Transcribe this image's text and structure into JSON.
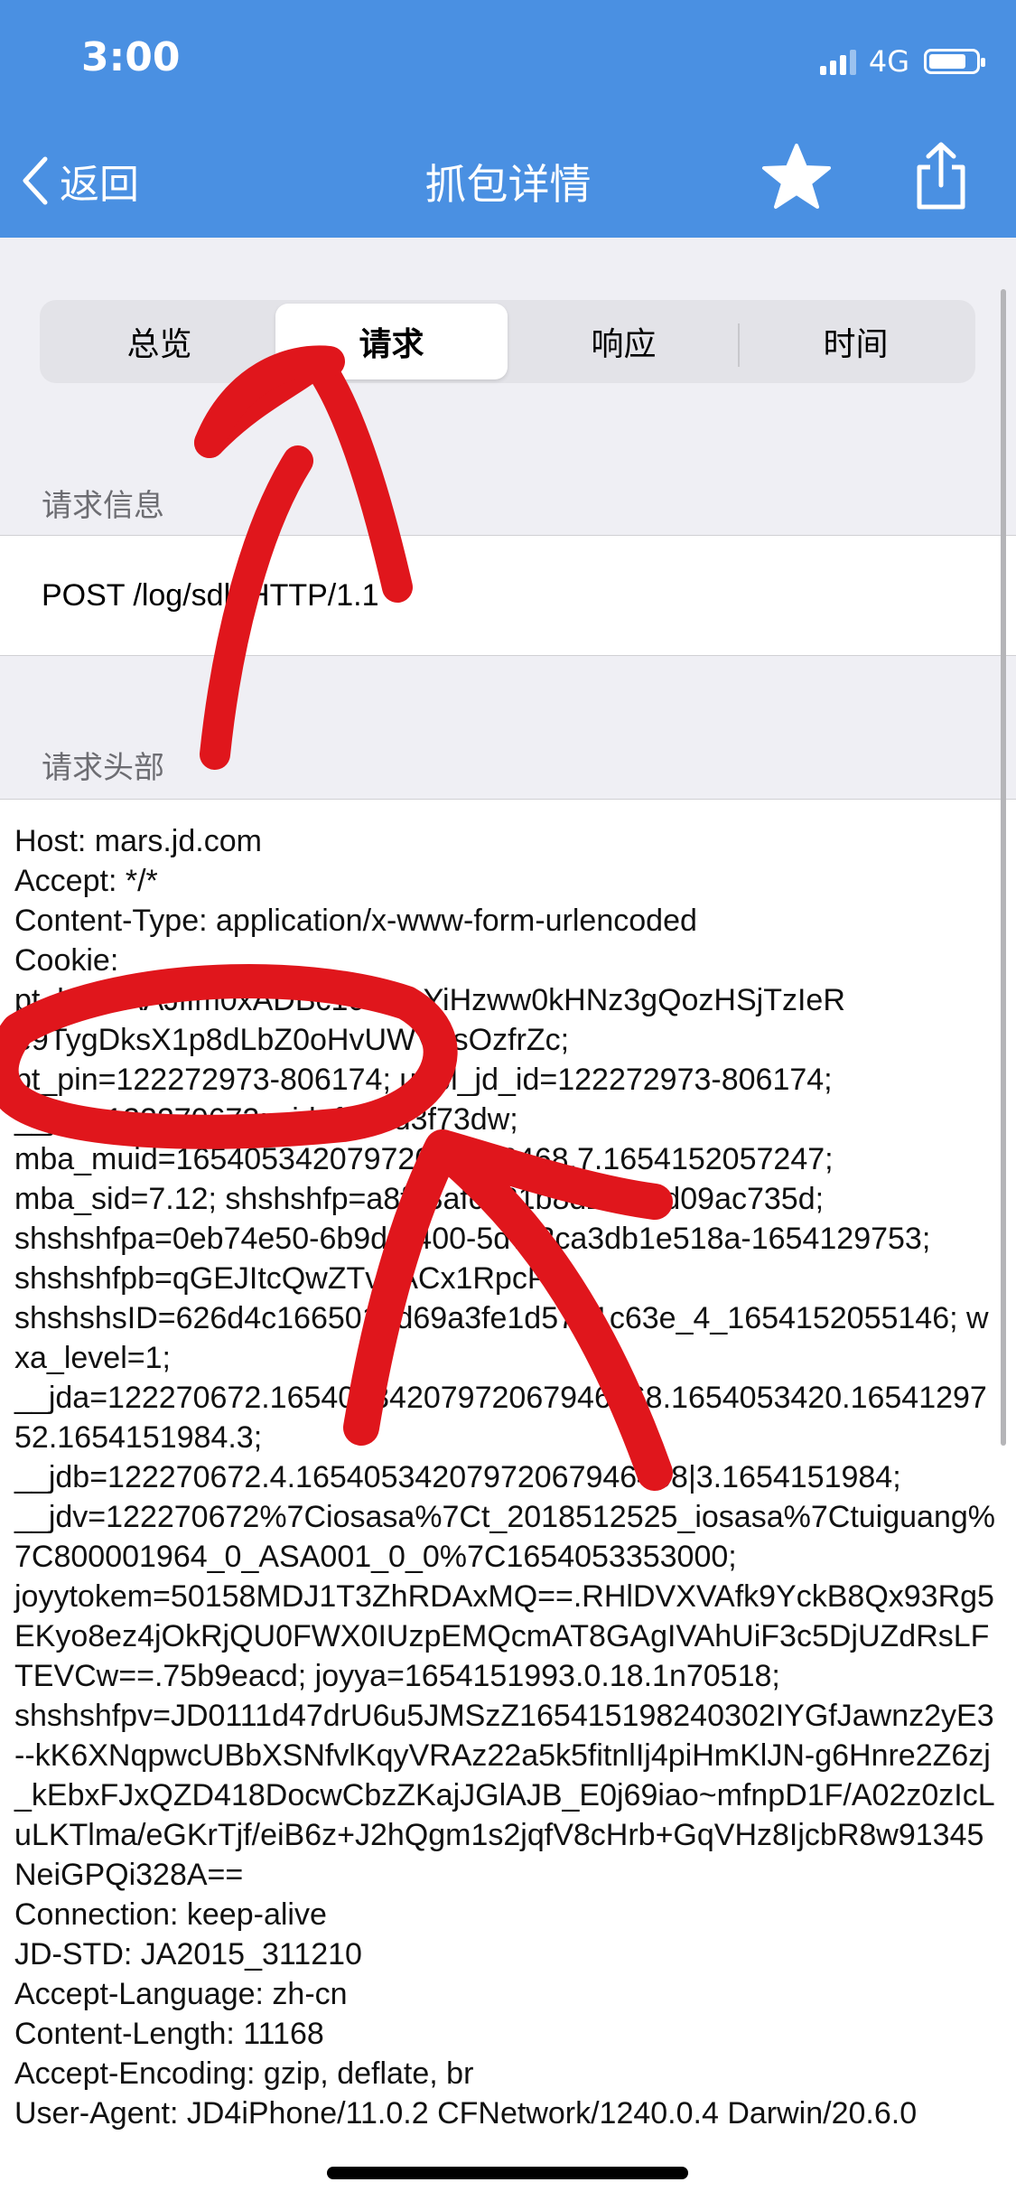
{
  "status_bar": {
    "time": "3:00",
    "network": "4G",
    "battery_level": 0.8
  },
  "nav": {
    "back_label": "返回",
    "title": "抓包详情",
    "star_icon": "star-icon",
    "share_icon": "share-icon"
  },
  "tabs": [
    {
      "label": "总览"
    },
    {
      "label": "请求"
    },
    {
      "label": "响应"
    },
    {
      "label": "时间"
    }
  ],
  "active_tab": "请求",
  "request_info": {
    "header": "请求信息",
    "line": "POST /log/sdk HTTP/1.1"
  },
  "request_headers": {
    "header": "请求头部",
    "lines": [
      "Host: mars.jd.com",
      "Accept: */*",
      "Content-Type: application/x-www-form-urlencoded",
      "Cookie:",
      "pt_key=AAJiIm0xADBc10VE_YiHzww0kHNz3gQozHSjTzIeR",
      "e9TygDksX1p8dLbZ0oHvUWVhsOzfrZc;",
      "pt_pin=122272973-806174; unpl_jd_id=122272973-806174;",
      "__jdc=122270672; sid=f240d3f73dw;",
      "mba_muid=16540534207972067946468.7.1654152057247;",
      "mba_sid=7.12; shshshfp=a8fd3afc321b8d27af5d09ac735d;",
      "shshshfpa=0eb74e50-6b9d-8400-5d7-2ca3db1e518a-1654129753;",
      "shshshfpb=qGEJItcQwZTvbACx1RpcPQ;",
      "shshshsID=626d4c1665019d69a3fe1d5781c63e_4_1654152055146; wxa_level=1;",
      "__jda=122270672.16540534207972067946468.1654053420.1654129752.1654151984.3;",
      "__jdb=122270672.4.16540534207972067946468|3.1654151984;",
      "__jdv=122270672%7Ciosasa%7Ct_2018512525_iosasa%7Ctuiguang%7C800001964_0_ASA001_0_0%7C1654053353000;",
      "joyytokem=50158MDJ1T3ZhRDAxMQ==.RHlDVXVAfk9YckB8Qx93Rg5EKyo8ez4jOkRjQU0FWX0IUzpEMQcmAT8GAgIVAhUiF3c5DjUZdRsLFTEVCw==.75b9eacd; joyya=1654151993.0.18.1n70518;",
      "shshshfpv=JD0111d47drU6u5JMSzZ165415198240302IYGfJawnz2yE3--kK6XNqpwcUBbXSNfvlKqyVRAz22a5k5fitnlIj4piHmKlJN-g6Hnre2Z6zj_kEbxFJxQZD418DocwCbzZKajJGlAJB_E0j69iao~mfnpD1F/A02z0zIcLuLKTlma/eGKrTjf/eiB6z+J2hQgm1s2jqfV8cHrb+GqVHz8IjcbR8w91345NeiGPQi328A==",
      "Connection: keep-alive",
      "JD-STD: JA2015_311210",
      "Accept-Language: zh-cn",
      "Content-Length: 11168",
      "Accept-Encoding: gzip, deflate, br",
      "User-Agent: JD4iPhone/11.0.2 CFNetwork/1240.0.4 Darwin/20.6.0"
    ]
  },
  "annotation_color": "#e0161c"
}
